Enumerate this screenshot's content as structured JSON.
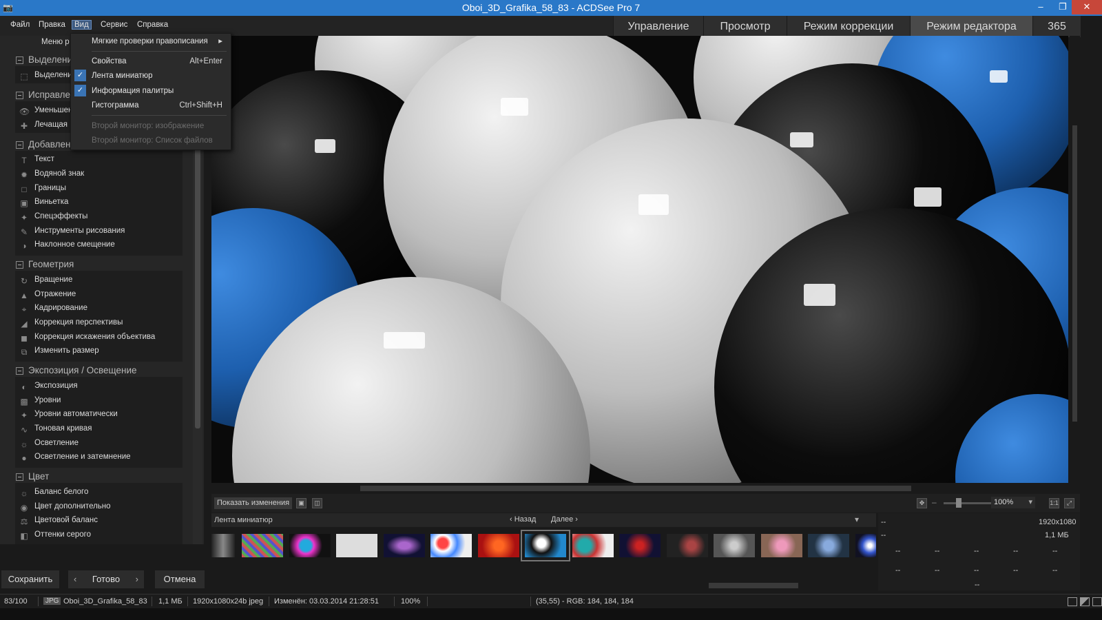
{
  "window": {
    "title": "Oboi_3D_Grafika_58_83 - ACDSee Pro 7",
    "minimize": "–",
    "restore": "❐",
    "close": "✕"
  },
  "menubar": [
    "Файл",
    "Правка",
    "Вид",
    "Сервис",
    "Справка"
  ],
  "mode_tabs": [
    "Управление",
    "Просмотр",
    "Режим коррекции",
    "Режим редактора",
    "365"
  ],
  "active_mode": "Режим редактора",
  "view_menu": {
    "items": [
      {
        "label": "Мягкие проверки правописания",
        "shortcut": "",
        "submenu": true
      },
      {
        "label": "Свойства",
        "shortcut": "Alt+Enter"
      },
      {
        "label": "Лента миниатюр",
        "checked": true
      },
      {
        "label": "Информация палитры",
        "checked": true
      },
      {
        "label": "Гистограмма",
        "shortcut": "Ctrl+Shift+H"
      },
      {
        "label": "Второй монитор: изображение",
        "disabled": true
      },
      {
        "label": "Второй монитор: Список файлов",
        "disabled": true
      }
    ]
  },
  "left_panel": {
    "menu_label": "Меню р",
    "groups": [
      {
        "title": "Выделени",
        "tools": [
          "Выделени"
        ]
      },
      {
        "title": "Исправле",
        "tools": [
          "Уменьшен",
          "Лечащая к"
        ]
      },
      {
        "title": "Добавлен",
        "tools": [
          "Текст",
          "Водяной знак",
          "Границы",
          "Виньетка",
          "Спецэффекты",
          "Инструменты рисования",
          "Наклонное смещение"
        ]
      },
      {
        "title": "Геометрия",
        "tools": [
          "Вращение",
          "Отражение",
          "Кадрирование",
          "Коррекция перспективы",
          "Коррекция искажения объектива",
          "Изменить размер"
        ]
      },
      {
        "title": "Экспозиция / Освещение",
        "tools": [
          "Экспозиция",
          "Уровни",
          "Уровни автоматически",
          "Тоновая кривая",
          "Осветление",
          "Осветление и затемнение"
        ]
      },
      {
        "title": "Цвет",
        "tools": [
          "Баланс белого",
          "Цвет дополнительно",
          "Цветовой баланс",
          "Оттенки серого"
        ]
      }
    ]
  },
  "view_toolbar": {
    "show_changes": "Показать изменения",
    "zoom": "100%"
  },
  "filmstrip": {
    "label": "Лента миниатюр",
    "back": "Назад",
    "next": "Далее"
  },
  "info_panel": {
    "dash": "--",
    "resolution": "1920x1080",
    "size": "1,1 МБ"
  },
  "bottom_buttons": {
    "save": "Сохранить",
    "done": "Готово",
    "cancel": "Отмена"
  },
  "status": {
    "index": "83/100",
    "format": "JPG",
    "filename": "Oboi_3D_Grafika_58_83",
    "filesize": "1,1 МБ",
    "dims": "1920x1080x24b jpeg",
    "modified": "Изменён: 03.03.2014 21:28:51",
    "zoom": "100%",
    "pixel": "(35,55) - RGB: 184, 184, 184"
  },
  "colors": {
    "title_bar": "#2a78c8",
    "accent": "#3a74b5",
    "close": "#c7473a"
  }
}
